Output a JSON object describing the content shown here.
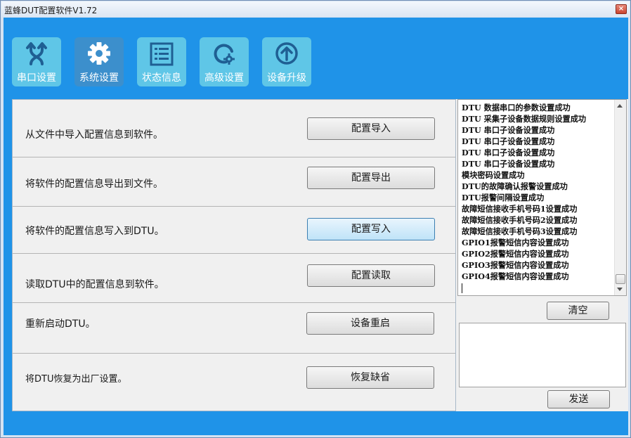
{
  "window": {
    "title": "蓝蜂DUT配置软件V1.72",
    "close_label": "×"
  },
  "toolbar": {
    "buttons": [
      {
        "label": "串口设置",
        "icon": "serial-cross-arrows-icon",
        "active": false
      },
      {
        "label": "系统设置",
        "icon": "gear-icon",
        "active": true
      },
      {
        "label": "状态信息",
        "icon": "list-icon",
        "active": false
      },
      {
        "label": "高级设置",
        "icon": "advanced-gear-circle-icon",
        "active": false
      },
      {
        "label": "设备升级",
        "icon": "upgrade-arrow-icon",
        "active": false
      }
    ]
  },
  "actions": {
    "rows": [
      {
        "description": "从文件中导入配置信息到软件。",
        "button": "配置导入"
      },
      {
        "description": "将软件的配置信息导出到文件。",
        "button": "配置导出"
      },
      {
        "description": "将软件的配置信息写入到DTU。",
        "button": "配置写入"
      },
      {
        "description": "读取DTU中的配置信息到软件。",
        "button": "配置读取"
      },
      {
        "description": "重新启动DTU。",
        "button": "设备重启"
      },
      {
        "description": "将DTU恢复为出厂设置。",
        "button": "恢复缺省"
      }
    ]
  },
  "log": {
    "lines": [
      "DTU 数据串口的参数设置成功",
      "DTU 采集子设备数据规则设置成功",
      "DTU 串口子设备设置成功",
      "DTU 串口子设备设置成功",
      "DTU 串口子设备设置成功",
      "DTU 串口子设备设置成功",
      "模块密码设置成功",
      "DTU的故障确认报警设置成功",
      "DTU报警间隔设置成功",
      "故障短信接收手机号码1设置成功",
      "故障短信接收手机号码2设置成功",
      "故障短信接收手机号码3设置成功",
      "GPIO1报警短信内容设置成功",
      "GPIO2报警短信内容设置成功",
      "GPIO3报警短信内容设置成功",
      "GPIO4报警短信内容设置成功"
    ],
    "clear_label": "清空",
    "send_value": "",
    "send_label": "发送"
  },
  "colors": {
    "client_bg": "#1f93e8",
    "tool_button": "#5fc6e7",
    "tool_button_active": "#3c8fcc"
  }
}
